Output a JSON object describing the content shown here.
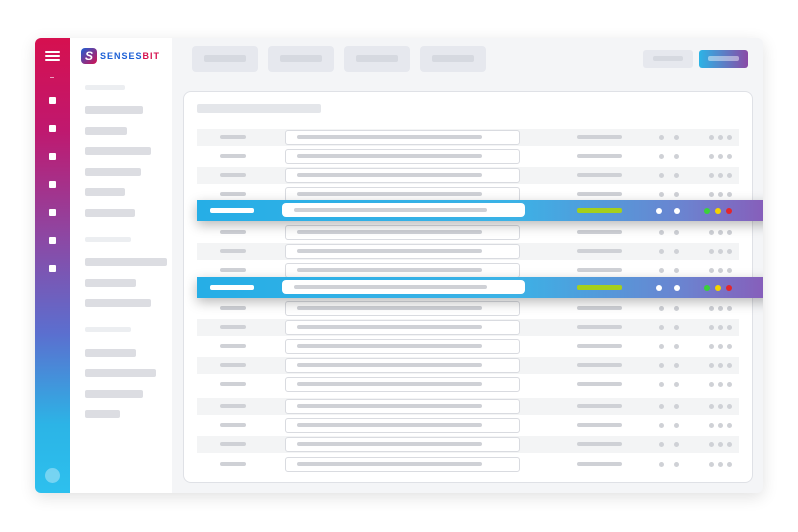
{
  "app": {
    "logo_mark": "S",
    "logo_word_part1": "SENSES",
    "logo_word_part2": "BIT"
  },
  "colors": {
    "brand_blue": "#1b5fd6",
    "brand_red": "#d6104f",
    "accent_gradient_start": "#2cb4e6",
    "accent_gradient_end": "#8a4aa6",
    "status_green": "#3ad13a",
    "status_yellow": "#f5d400",
    "status_red": "#e3262c",
    "highlight_bar": "#a5cf1c"
  },
  "icons": {
    "rail_menu": "hamburger-icon",
    "rail_nav_items": 7,
    "rail_bottom": "avatar-icon"
  },
  "table": {
    "row_count": 18,
    "highlighted_rows": [
      4,
      8
    ],
    "highlighted_row_status_dots": [
      "green",
      "yellow",
      "red"
    ]
  }
}
